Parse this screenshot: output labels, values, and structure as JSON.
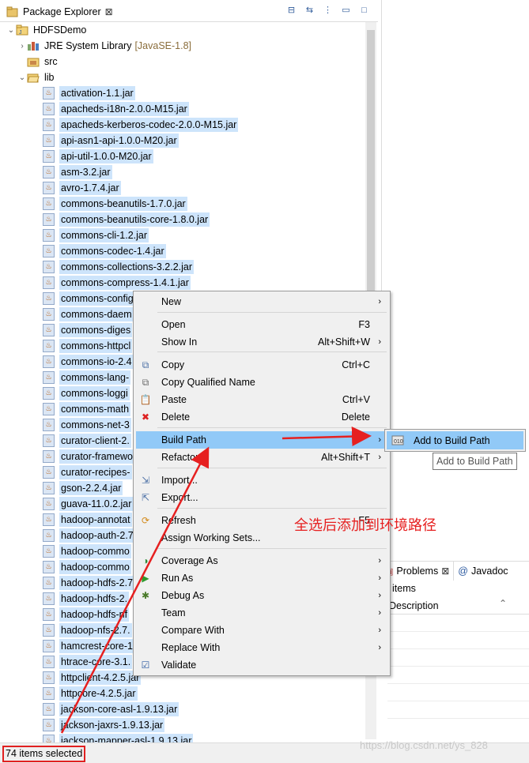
{
  "explorer": {
    "tab_title": "Package Explorer",
    "tab_close": "⊠",
    "tools": [
      "⊟",
      "⇆",
      "⋮",
      "▭",
      "□"
    ]
  },
  "tree": {
    "project": "HDFSDemo",
    "jre": "JRE System Library",
    "jre_version": "[JavaSE-1.8]",
    "src": "src",
    "lib": "lib",
    "jars": [
      "activation-1.1.jar",
      "apacheds-i18n-2.0.0-M15.jar",
      "apacheds-kerberos-codec-2.0.0-M15.jar",
      "api-asn1-api-1.0.0-M20.jar",
      "api-util-1.0.0-M20.jar",
      "asm-3.2.jar",
      "avro-1.7.4.jar",
      "commons-beanutils-1.7.0.jar",
      "commons-beanutils-core-1.8.0.jar",
      "commons-cli-1.2.jar",
      "commons-codec-1.4.jar",
      "commons-collections-3.2.2.jar",
      "commons-compress-1.4.1.jar",
      "commons-config",
      "commons-daem",
      "commons-diges",
      "commons-httpcl",
      "commons-io-2.4",
      "commons-lang-",
      "commons-loggi",
      "commons-math",
      "commons-net-3",
      "curator-client-2.",
      "curator-framewo",
      "curator-recipes-",
      "gson-2.2.4.jar",
      "guava-11.0.2.jar",
      "hadoop-annotat",
      "hadoop-auth-2.7",
      "hadoop-commo",
      "hadoop-commo",
      "hadoop-hdfs-2.7",
      "hadoop-hdfs-2.",
      "hadoop-hdfs-nf",
      "hadoop-nfs-2.7.",
      "hamcrest-core-1",
      "htrace-core-3.1.",
      "httpclient-4.2.5.jar",
      "httpcore-4.2.5.jar",
      "jackson-core-asl-1.9.13.jar",
      "jackson-jaxrs-1.9.13.jar",
      "jackson-mapper-asl-1.9.13.jar"
    ]
  },
  "context_menu": {
    "items": [
      {
        "label": "New",
        "shortcut": "",
        "submenu": true,
        "icon": ""
      },
      {
        "label": "Open",
        "shortcut": "F3",
        "submenu": false,
        "icon": ""
      },
      {
        "label": "Show In",
        "shortcut": "Alt+Shift+W",
        "submenu": true,
        "icon": ""
      },
      {
        "label": "Copy",
        "shortcut": "Ctrl+C",
        "submenu": false,
        "icon": "copy-icon"
      },
      {
        "label": "Copy Qualified Name",
        "shortcut": "",
        "submenu": false,
        "icon": "copy-qualified-icon"
      },
      {
        "label": "Paste",
        "shortcut": "Ctrl+V",
        "submenu": false,
        "icon": "paste-icon"
      },
      {
        "label": "Delete",
        "shortcut": "Delete",
        "submenu": false,
        "icon": "delete-icon"
      },
      {
        "label": "Build Path",
        "shortcut": "",
        "submenu": true,
        "icon": ""
      },
      {
        "label": "Refactor",
        "shortcut": "Alt+Shift+T",
        "submenu": true,
        "icon": ""
      },
      {
        "label": "Import...",
        "shortcut": "",
        "submenu": false,
        "icon": "import-icon"
      },
      {
        "label": "Export...",
        "shortcut": "",
        "submenu": false,
        "icon": "export-icon"
      },
      {
        "label": "Refresh",
        "shortcut": "F5",
        "submenu": false,
        "icon": "refresh-icon"
      },
      {
        "label": "Assign Working Sets...",
        "shortcut": "",
        "submenu": false,
        "icon": ""
      },
      {
        "label": "Coverage As",
        "shortcut": "",
        "submenu": true,
        "icon": "coverage-icon"
      },
      {
        "label": "Run As",
        "shortcut": "",
        "submenu": true,
        "icon": "run-icon"
      },
      {
        "label": "Debug As",
        "shortcut": "",
        "submenu": true,
        "icon": "debug-icon"
      },
      {
        "label": "Team",
        "shortcut": "",
        "submenu": true,
        "icon": ""
      },
      {
        "label": "Compare With",
        "shortcut": "",
        "submenu": true,
        "icon": ""
      },
      {
        "label": "Replace With",
        "shortcut": "",
        "submenu": true,
        "icon": ""
      },
      {
        "label": "Validate",
        "shortcut": "",
        "submenu": false,
        "icon": "check-icon"
      }
    ]
  },
  "submenu": {
    "label": "Add to Build Path",
    "tooltip": "Add to Build Path"
  },
  "problems": {
    "tab_problems": "Problems",
    "tab_close": "⊠",
    "tab_javadoc": "Javadoc",
    "items_text": "items",
    "column_description": "Description"
  },
  "annotation": "全选后添加到环境路径",
  "status": {
    "text": "74 items selected"
  },
  "watermark": "https://blog.csdn.net/ys_828",
  "colors": {
    "selection": "#cde4fb",
    "menu_highlight": "#91c9f7",
    "annotation_red": "#e62020"
  }
}
